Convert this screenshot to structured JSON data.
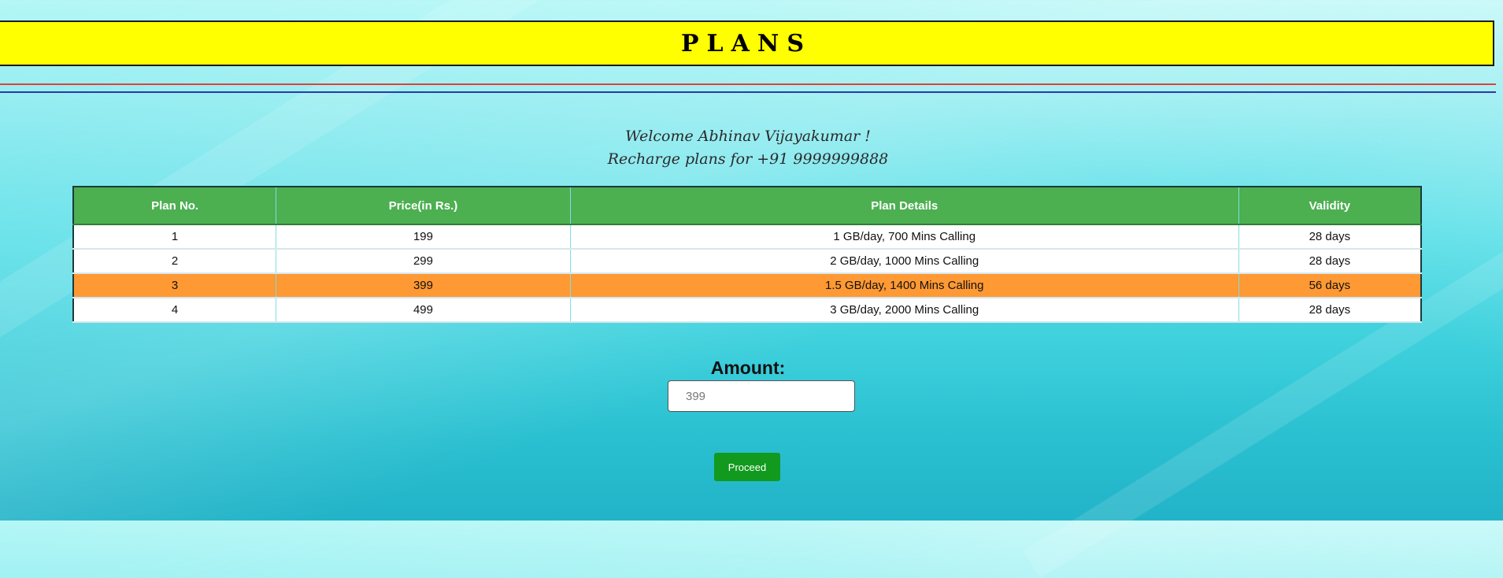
{
  "header": {
    "title": "PLANS"
  },
  "welcome": {
    "greeting": "Welcome Abhinav Vijayakumar !",
    "subtitle": "Recharge plans for +91 9999999888"
  },
  "table": {
    "headers": [
      "Plan No.",
      "Price(in Rs.)",
      "Plan Details",
      "Validity"
    ],
    "rows": [
      [
        "1",
        "199",
        "1 GB/day, 700 Mins Calling",
        "28 days"
      ],
      [
        "2",
        "299",
        "2 GB/day, 1000 Mins Calling",
        "28 days"
      ],
      [
        "3",
        "399",
        "1.5 GB/day, 1400 Mins Calling",
        "56 days"
      ],
      [
        "4",
        "499",
        "3 GB/day, 2000 Mins Calling",
        "28 days"
      ]
    ],
    "selected_row": 2,
    "header_color": "#4caf50",
    "selected_color": "#ff9933"
  },
  "amount": {
    "label": "Amount:",
    "placeholder": "399"
  },
  "actions": {
    "proceed_label": "Proceed"
  },
  "colors": {
    "title_bar": "#ffff00",
    "proceed_button": "#119a1e"
  }
}
